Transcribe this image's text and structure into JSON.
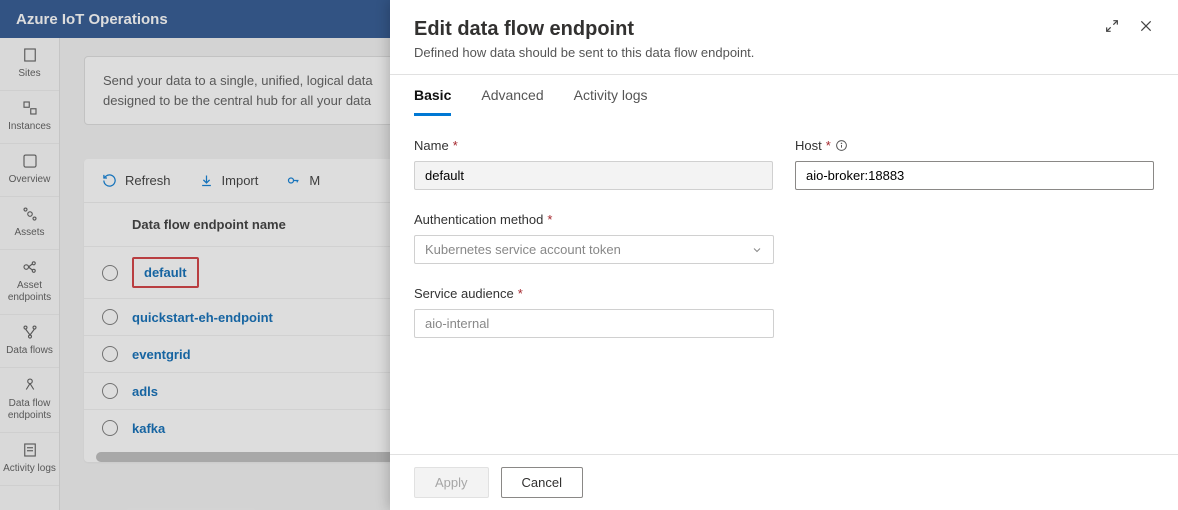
{
  "header": {
    "title": "Azure IoT Operations"
  },
  "sidebar": {
    "items": [
      {
        "label": "Sites"
      },
      {
        "label": "Instances"
      },
      {
        "label": "Overview"
      },
      {
        "label": "Assets"
      },
      {
        "label": "Asset endpoints"
      },
      {
        "label": "Data flows"
      },
      {
        "label": "Data flow endpoints"
      },
      {
        "label": "Activity logs"
      }
    ]
  },
  "info": {
    "line1": "Send your data to a single, unified, logical data",
    "line2": "designed to be the central hub for all your data"
  },
  "toolbar": {
    "refresh": "Refresh",
    "import": "Import",
    "more": "M"
  },
  "table": {
    "header": "Data flow endpoint name",
    "rows": [
      {
        "name": "default",
        "highlighted": true
      },
      {
        "name": "quickstart-eh-endpoint"
      },
      {
        "name": "eventgrid"
      },
      {
        "name": "adls"
      },
      {
        "name": "kafka"
      }
    ]
  },
  "panel": {
    "title": "Edit data flow endpoint",
    "subtitle": "Defined how data should be sent to this data flow endpoint.",
    "tabs": [
      {
        "label": "Basic",
        "active": true
      },
      {
        "label": "Advanced"
      },
      {
        "label": "Activity logs"
      }
    ],
    "form": {
      "name_label": "Name",
      "name_value": "default",
      "host_label": "Host",
      "host_value": "aio-broker:18883",
      "auth_label": "Authentication method",
      "auth_value": "Kubernetes service account token",
      "audience_label": "Service audience",
      "audience_value": "aio-internal"
    },
    "footer": {
      "apply": "Apply",
      "cancel": "Cancel"
    }
  }
}
